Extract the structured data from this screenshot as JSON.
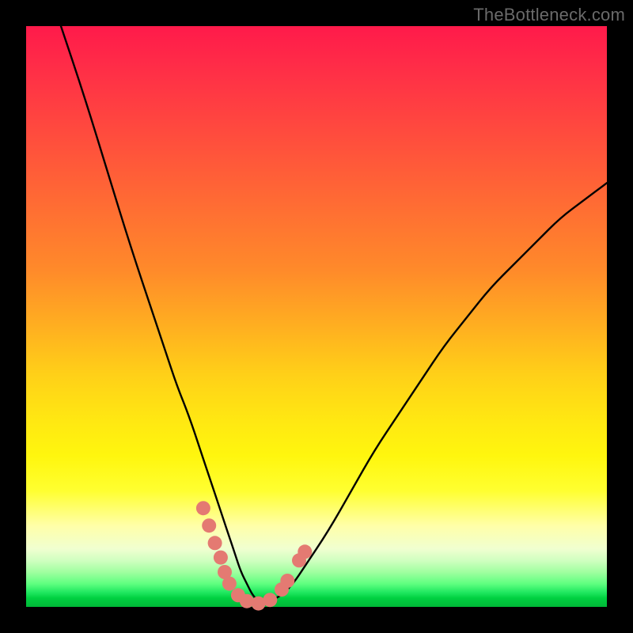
{
  "watermark": "TheBottleneck.com",
  "chart_data": {
    "type": "line",
    "title": "",
    "xlabel": "",
    "ylabel": "",
    "xlim": [
      0,
      100
    ],
    "ylim": [
      0,
      100
    ],
    "grid": false,
    "series": [
      {
        "name": "black-curve",
        "color": "#000000",
        "x": [
          6,
          10,
          14,
          18,
          22,
          24,
          26,
          28,
          30,
          32,
          33,
          34,
          35,
          36,
          37,
          38,
          39,
          40,
          41,
          42,
          44,
          46,
          48,
          52,
          56,
          60,
          64,
          68,
          72,
          76,
          80,
          84,
          88,
          92,
          96,
          100
        ],
        "values": [
          100,
          88,
          75,
          62,
          50,
          44,
          38,
          33,
          27,
          21,
          18,
          15,
          12,
          9,
          6,
          4,
          2,
          1,
          0.5,
          1,
          2,
          4,
          7,
          13,
          20,
          27,
          33,
          39,
          45,
          50,
          55,
          59,
          63,
          67,
          70,
          73
        ]
      },
      {
        "name": "salmon-markers",
        "color": "#e47a72",
        "x": [
          30.5,
          31.5,
          32.5,
          33.5,
          34.2,
          35.0,
          36.5,
          38.0,
          40.0,
          42.0,
          44.0,
          45.0,
          47.0,
          48.0
        ],
        "values": [
          17.0,
          14.0,
          11.0,
          8.5,
          6.0,
          4.0,
          2.0,
          1.0,
          0.6,
          1.2,
          3.0,
          4.5,
          8.0,
          9.5
        ]
      }
    ]
  }
}
